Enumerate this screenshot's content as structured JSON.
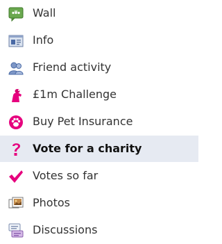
{
  "nav": {
    "active_index": 5,
    "items": [
      {
        "label": "Wall",
        "icon": "speech-bubble-icon"
      },
      {
        "label": "Info",
        "icon": "id-card-icon"
      },
      {
        "label": "Friend activity",
        "icon": "friends-icon"
      },
      {
        "label": "£1m Challenge",
        "icon": "pink-figure-icon"
      },
      {
        "label": "Buy Pet Insurance",
        "icon": "paw-icon"
      },
      {
        "label": "Vote for a charity",
        "icon": "question-mark-icon"
      },
      {
        "label": "Votes so far",
        "icon": "checkmark-icon"
      },
      {
        "label": "Photos",
        "icon": "photos-icon"
      },
      {
        "label": "Discussions",
        "icon": "discussions-icon"
      }
    ]
  },
  "colors": {
    "active_background": "#e6eaf2",
    "text": "#333333",
    "wall_icon": "#6aa84f",
    "brand_pink": "#e6007e"
  }
}
